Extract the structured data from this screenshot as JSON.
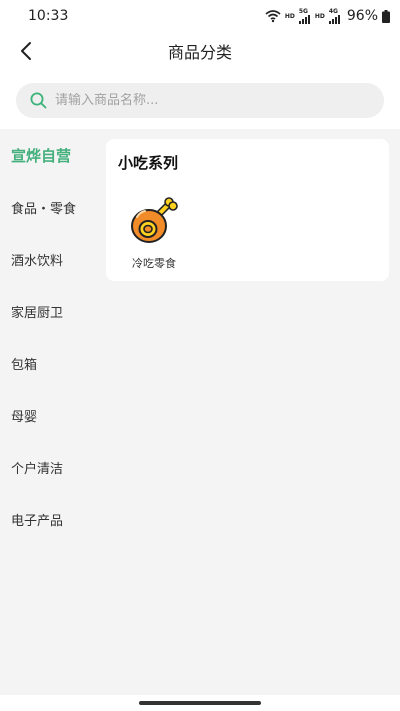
{
  "status_bar": {
    "time": "10:33",
    "hd_label": "HD",
    "signal_5g_label": "5G",
    "signal_4g_label": "4G",
    "battery_percent": "96%"
  },
  "header": {
    "title": "商品分类"
  },
  "search": {
    "placeholder": "请输入商品名称..."
  },
  "sidebar": {
    "items": [
      {
        "label": "宣烨自营",
        "active": true
      },
      {
        "label": "食品・零食"
      },
      {
        "label": "酒水饮料"
      },
      {
        "label": "家居厨卫"
      },
      {
        "label": "包箱"
      },
      {
        "label": "母婴"
      },
      {
        "label": "个户清洁"
      },
      {
        "label": "电子产品"
      }
    ]
  },
  "content": {
    "section_title": "小吃系列",
    "products": [
      {
        "label": "冷吃零食",
        "icon": "drumstick-icon"
      }
    ]
  },
  "colors": {
    "accent_green": "#45b07e",
    "search_icon_green": "#3cb37a",
    "icon_orange": "#f28c28",
    "icon_yellow": "#ffd21f"
  }
}
